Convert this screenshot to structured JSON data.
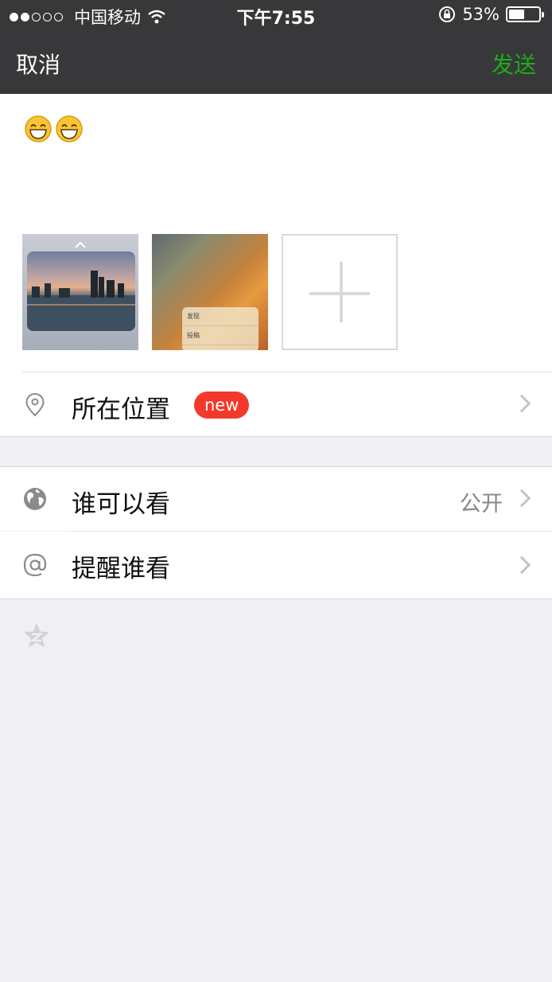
{
  "status_bar": {
    "carrier": "中国移动",
    "time": "下午7:55",
    "battery_percent": "53%",
    "battery_level": 0.53,
    "signal_strength": 2,
    "signal_max": 5
  },
  "nav": {
    "cancel_label": "取消",
    "send_label": "发送",
    "send_color": "#1aad19"
  },
  "compose": {
    "text_emojis": [
      "grinning-face-emoji",
      "grinning-face-emoji"
    ],
    "photo2_menu": [
      "发现",
      "投稿"
    ],
    "add_photo_icon": "plus-icon"
  },
  "rows": {
    "location": {
      "label": "所在位置",
      "badge": "new",
      "icon": "location-pin-icon",
      "badge_color": "#f2392a"
    },
    "visibility": {
      "label": "谁可以看",
      "value": "公开",
      "icon": "globe-icon"
    },
    "mention": {
      "label": "提醒谁看",
      "icon": "at-sign-icon"
    }
  },
  "bottom": {
    "icon": "qzone-star-icon"
  }
}
